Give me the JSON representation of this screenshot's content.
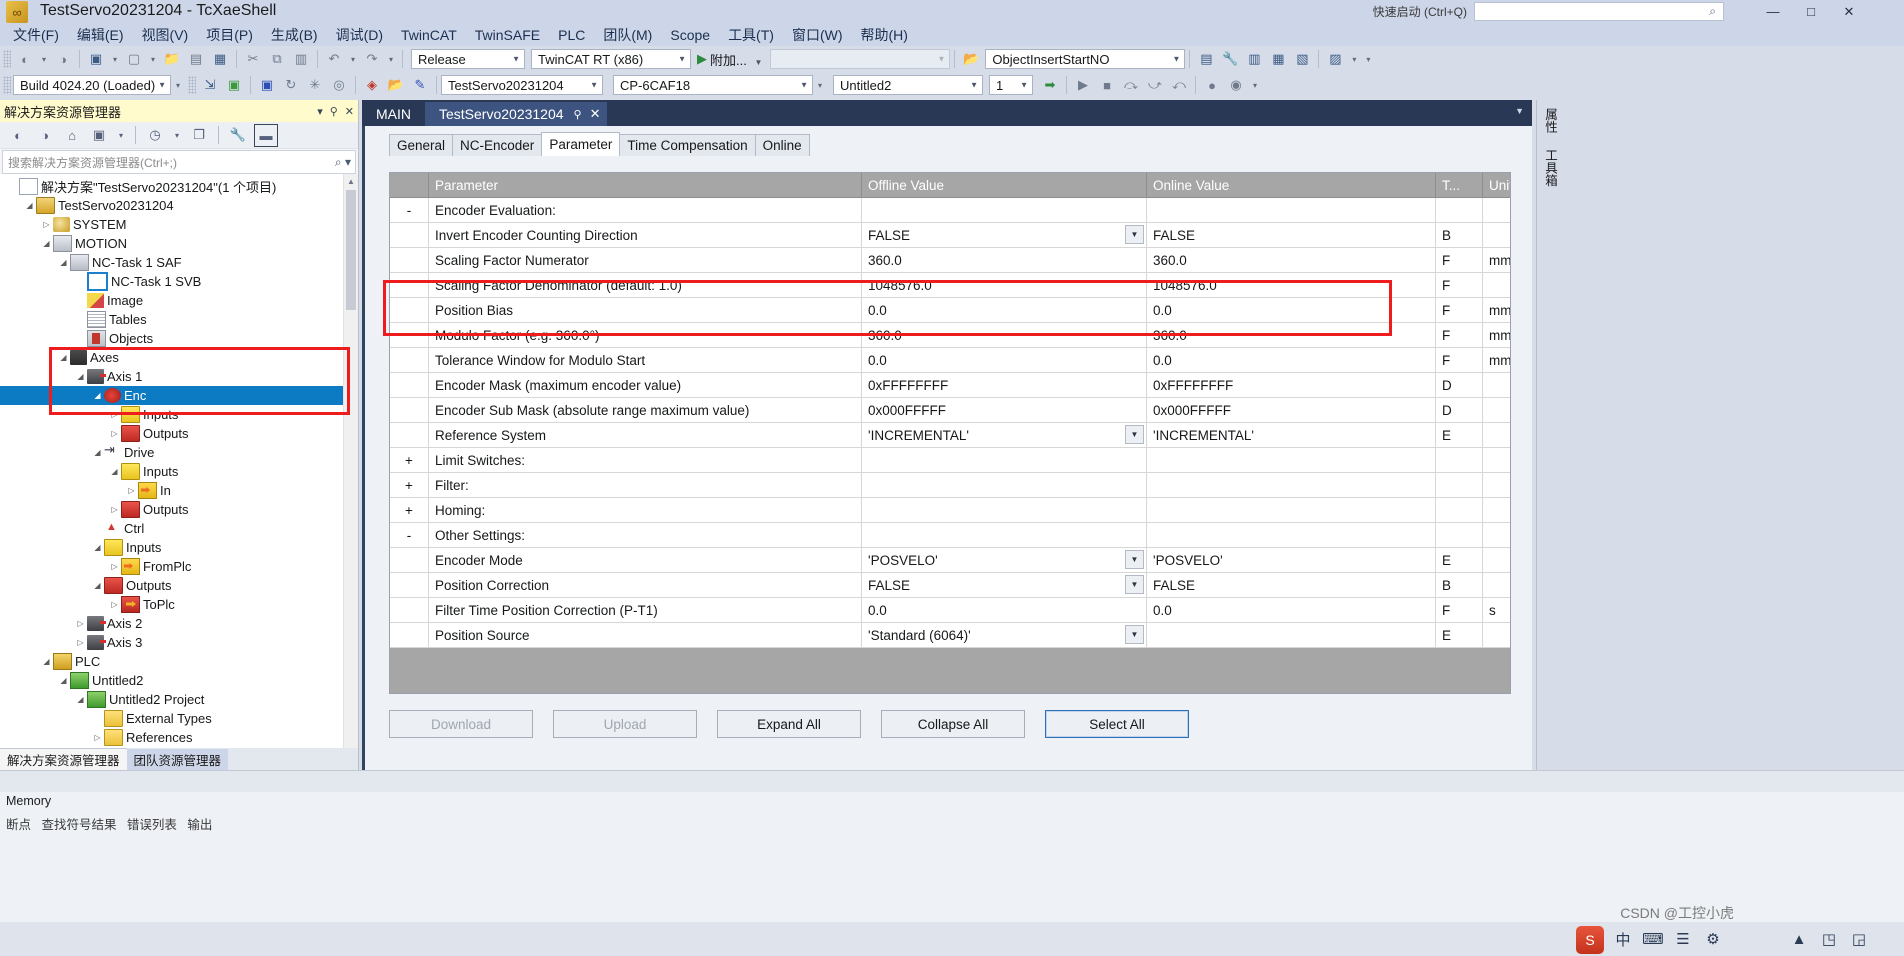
{
  "window": {
    "title": "TestServo20231204 - TcXaeShell",
    "quick_launch_placeholder": "快速启动 (Ctrl+Q)",
    "minimize": "—",
    "maximize": "□",
    "close": "✕",
    "app_icon": "visual-studio-icon"
  },
  "menubar": {
    "items": [
      {
        "label": "文件(F)"
      },
      {
        "label": "编辑(E)"
      },
      {
        "label": "视图(V)"
      },
      {
        "label": "项目(P)"
      },
      {
        "label": "生成(B)"
      },
      {
        "label": "调试(D)"
      },
      {
        "label": "TwinCAT"
      },
      {
        "label": "TwinSAFE"
      },
      {
        "label": "PLC"
      },
      {
        "label": "团队(M)"
      },
      {
        "label": "Scope"
      },
      {
        "label": "工具(T)"
      },
      {
        "label": "窗口(W)"
      },
      {
        "label": "帮助(H)"
      }
    ]
  },
  "toolbar1": {
    "configuration": "Release",
    "platform": "TwinCAT RT (x86)",
    "run_label": "附加...",
    "empty_combo": "",
    "object_combo": "ObjectInsertStartNO"
  },
  "toolbar2": {
    "build_combo": "Build 4024.20 (Loaded)",
    "target_system": "TestServo20231204",
    "target_device": "CP-6CAF18",
    "plc_project": "Untitled2",
    "instance": "1"
  },
  "solution_explorer": {
    "title": "解决方案资源管理器",
    "pin": "⚲",
    "close": "✕",
    "search_placeholder": "搜索解决方案资源管理器(Ctrl+;)",
    "search_icon": "search-icon",
    "toolbar_icons": [
      "back-icon",
      "forward-icon",
      "home-icon",
      "refresh-icon",
      "pending-changes-icon",
      "show-all-files-icon",
      "properties-icon",
      "preview-icon"
    ],
    "tabs": [
      {
        "label": "解决方案资源管理器",
        "active": true
      },
      {
        "label": "团队资源管理器",
        "active": false
      }
    ],
    "tree": [
      {
        "label": "解决方案\"TestServo20231204\"(1 个项目)",
        "depth": 0,
        "expander": "",
        "icon": "i-sol",
        "icon_name": "solution-icon"
      },
      {
        "label": "TestServo20231204",
        "depth": 1,
        "expander": "◢",
        "icon": "i-proj",
        "icon_name": "project-icon"
      },
      {
        "label": "SYSTEM",
        "depth": 2,
        "expander": "▷",
        "icon": "i-sys",
        "icon_name": "system-icon"
      },
      {
        "label": "MOTION",
        "depth": 2,
        "expander": "◢",
        "icon": "i-mot",
        "icon_name": "motion-icon"
      },
      {
        "label": "NC-Task 1 SAF",
        "depth": 3,
        "expander": "◢",
        "icon": "i-saf",
        "icon_name": "nc-task-saf-icon"
      },
      {
        "label": "NC-Task 1 SVB",
        "depth": 4,
        "expander": "",
        "icon": "i-svb",
        "icon_name": "nc-task-svb-icon"
      },
      {
        "label": "Image",
        "depth": 4,
        "expander": "",
        "icon": "i-img",
        "icon_name": "image-icon"
      },
      {
        "label": "Tables",
        "depth": 4,
        "expander": "",
        "icon": "i-tab",
        "icon_name": "tables-icon"
      },
      {
        "label": "Objects",
        "depth": 4,
        "expander": "",
        "icon": "i-obj",
        "icon_name": "objects-icon"
      },
      {
        "label": "Axes",
        "depth": 3,
        "expander": "◢",
        "icon": "i-axes",
        "icon_name": "axes-icon"
      },
      {
        "label": "Axis 1",
        "depth": 4,
        "expander": "◢",
        "icon": "i-axis",
        "icon_name": "axis-icon"
      },
      {
        "label": "Enc",
        "depth": 5,
        "expander": "◢",
        "icon": "i-enc",
        "icon_name": "encoder-icon",
        "selected": true
      },
      {
        "label": "Inputs",
        "depth": 6,
        "expander": "▷",
        "icon": "i-in",
        "icon_name": "inputs-icon"
      },
      {
        "label": "Outputs",
        "depth": 6,
        "expander": "▷",
        "icon": "i-out",
        "icon_name": "outputs-icon"
      },
      {
        "label": "Drive",
        "depth": 5,
        "expander": "◢",
        "icon": "i-drive",
        "icon_name": "drive-icon"
      },
      {
        "label": "Inputs",
        "depth": 6,
        "expander": "◢",
        "icon": "i-in",
        "icon_name": "inputs-icon"
      },
      {
        "label": "In",
        "depth": 7,
        "expander": "▷",
        "icon": "i-var-in",
        "icon_name": "variable-in-icon"
      },
      {
        "label": "Outputs",
        "depth": 6,
        "expander": "▷",
        "icon": "i-out",
        "icon_name": "outputs-icon"
      },
      {
        "label": "Ctrl",
        "depth": 5,
        "expander": "",
        "icon": "i-ctrl",
        "icon_name": "ctrl-icon"
      },
      {
        "label": "Inputs",
        "depth": 5,
        "expander": "◢",
        "icon": "i-in",
        "icon_name": "inputs-icon"
      },
      {
        "label": "FromPlc",
        "depth": 6,
        "expander": "▷",
        "icon": "i-var-in",
        "icon_name": "variable-fromplc-icon"
      },
      {
        "label": "Outputs",
        "depth": 5,
        "expander": "◢",
        "icon": "i-out",
        "icon_name": "outputs-icon"
      },
      {
        "label": "ToPlc",
        "depth": 6,
        "expander": "▷",
        "icon": "i-var-out",
        "icon_name": "variable-toplc-icon"
      },
      {
        "label": "Axis 2",
        "depth": 4,
        "expander": "▷",
        "icon": "i-axis",
        "icon_name": "axis-icon"
      },
      {
        "label": "Axis 3",
        "depth": 4,
        "expander": "▷",
        "icon": "i-axis",
        "icon_name": "axis-icon"
      },
      {
        "label": "PLC",
        "depth": 2,
        "expander": "◢",
        "icon": "i-plc",
        "icon_name": "plc-icon"
      },
      {
        "label": "Untitled2",
        "depth": 3,
        "expander": "◢",
        "icon": "i-plcprj",
        "icon_name": "plc-project-icon"
      },
      {
        "label": "Untitled2 Project",
        "depth": 4,
        "expander": "◢",
        "icon": "i-plcprj",
        "icon_name": "plc-project-node-icon"
      },
      {
        "label": "External Types",
        "depth": 5,
        "expander": "",
        "icon": "i-folder",
        "icon_name": "external-types-icon"
      },
      {
        "label": "References",
        "depth": 5,
        "expander": "▷",
        "icon": "i-refs",
        "icon_name": "references-icon"
      }
    ]
  },
  "editor": {
    "doc_tabs": [
      {
        "label": "MAIN",
        "active": false
      },
      {
        "label": "TestServo20231204",
        "active": true,
        "pin": "⚲",
        "close": "✕"
      }
    ],
    "property_tabs": [
      {
        "label": "General",
        "active": false
      },
      {
        "label": "NC-Encoder",
        "active": false
      },
      {
        "label": "Parameter",
        "active": true
      },
      {
        "label": "Time Compensation",
        "active": false
      },
      {
        "label": "Online",
        "active": false
      }
    ],
    "grid": {
      "columns": [
        "",
        "Parameter",
        "Offline Value",
        "Online Value",
        "T...",
        "Unit"
      ],
      "rows": [
        {
          "expander": "-",
          "name": "Encoder Evaluation:",
          "offline": "",
          "online": "",
          "type": "",
          "unit": "",
          "section": true
        },
        {
          "expander": "",
          "name": "Invert Encoder Counting Direction",
          "offline": "FALSE",
          "online": "FALSE",
          "type": "B",
          "unit": "",
          "dropdown": true
        },
        {
          "expander": "",
          "name": "Scaling Factor Numerator",
          "offline": "360.0",
          "online": "360.0",
          "type": "F",
          "unit": "mm/INC",
          "highlight": true
        },
        {
          "expander": "",
          "name": "Scaling Factor Denominator (default: 1.0)",
          "offline": "1048576.0",
          "online": "1048576.0",
          "type": "F",
          "unit": "",
          "highlight": true
        },
        {
          "expander": "",
          "name": "Position Bias",
          "offline": "0.0",
          "online": "0.0",
          "type": "F",
          "unit": "mm"
        },
        {
          "expander": "",
          "name": "Modulo Factor (e.g. 360.0°)",
          "offline": "360.0",
          "online": "360.0",
          "type": "F",
          "unit": "mm"
        },
        {
          "expander": "",
          "name": "Tolerance Window for Modulo Start",
          "offline": "0.0",
          "online": "0.0",
          "type": "F",
          "unit": "mm",
          "indent": true
        },
        {
          "expander": "",
          "name": "Encoder Mask (maximum encoder value)",
          "offline": "0xFFFFFFFF",
          "online": "0xFFFFFFFF",
          "type": "D",
          "unit": ""
        },
        {
          "expander": "",
          "name": "Encoder Sub Mask (absolute range maximum value)",
          "offline": "0x000FFFFF",
          "online": "0x000FFFFF",
          "type": "D",
          "unit": ""
        },
        {
          "expander": "",
          "name": "Reference System",
          "offline": "'INCREMENTAL'",
          "online": "'INCREMENTAL'",
          "type": "E",
          "unit": "",
          "dropdown": true
        },
        {
          "expander": "+",
          "name": "Limit Switches:",
          "offline": "",
          "online": "",
          "type": "",
          "unit": "",
          "section": true
        },
        {
          "expander": "+",
          "name": "Filter:",
          "offline": "",
          "online": "",
          "type": "",
          "unit": "",
          "section": true
        },
        {
          "expander": "+",
          "name": "Homing:",
          "offline": "",
          "online": "",
          "type": "",
          "unit": "",
          "section": true
        },
        {
          "expander": "-",
          "name": "Other Settings:",
          "offline": "",
          "online": "",
          "type": "",
          "unit": "",
          "section": true
        },
        {
          "expander": "",
          "name": "Encoder Mode",
          "offline": "'POSVELO'",
          "online": "'POSVELO'",
          "type": "E",
          "unit": "",
          "dropdown": true
        },
        {
          "expander": "",
          "name": "Position Correction",
          "offline": "FALSE",
          "online": "FALSE",
          "type": "B",
          "unit": "",
          "dropdown": true
        },
        {
          "expander": "",
          "name": "Filter Time Position Correction (P-T1)",
          "offline": "0.0",
          "online": "0.0",
          "type": "F",
          "unit": "s",
          "indent": true
        },
        {
          "expander": "",
          "name": "Position Source",
          "offline": "'Standard (6064)'",
          "online": "",
          "type": "E",
          "unit": "",
          "dropdown": true
        }
      ]
    },
    "buttons": [
      {
        "label": "Download",
        "state": "disabled"
      },
      {
        "label": "Upload",
        "state": "disabled"
      },
      {
        "label": "Expand All",
        "state": "normal"
      },
      {
        "label": "Collapse All",
        "state": "normal"
      },
      {
        "label": "Select All",
        "state": "selected"
      }
    ]
  },
  "right_dock": {
    "tabs": [
      {
        "label": "属性"
      },
      {
        "label": "工具箱"
      }
    ]
  },
  "bottom": {
    "title": "Memory",
    "items": [
      "断点",
      "查找符号结果",
      "错误列表",
      "输出"
    ],
    "watermark": "CSDN @工控小虎"
  },
  "colors": {
    "accent_blue": "#0d7ac4",
    "highlight_red": "#ee1c1c",
    "online_value": "#2d5ca8",
    "header_gray": "#a6a6a6",
    "title_yellow": "#fffbcc",
    "doc_tab_active": "#3e5480"
  }
}
